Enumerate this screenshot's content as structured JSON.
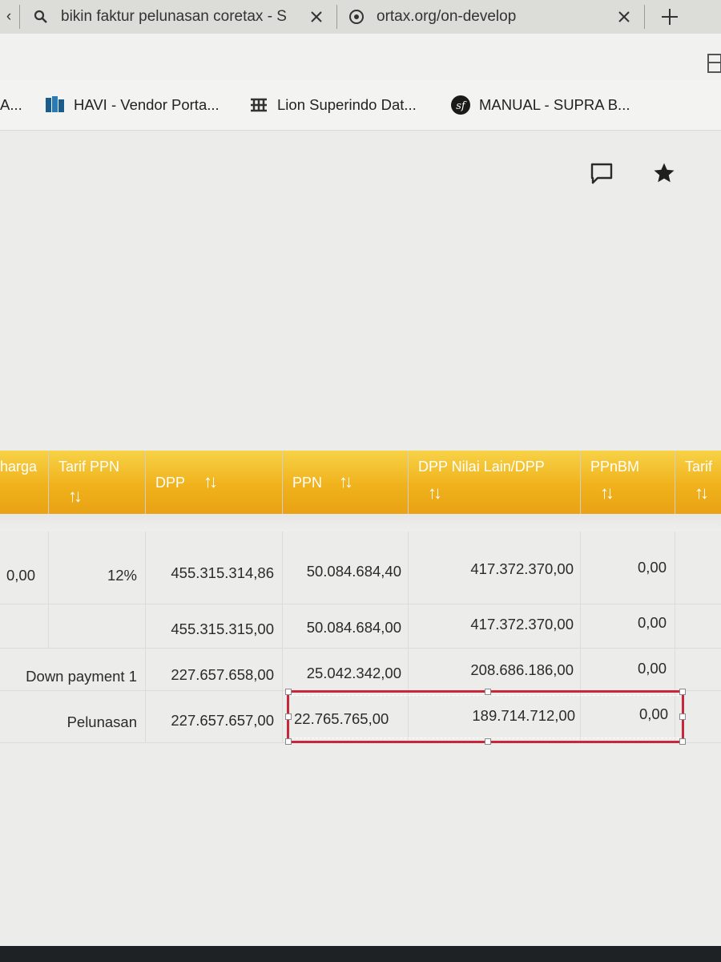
{
  "browser": {
    "back_glyph": "‹",
    "tabs": [
      {
        "title": "bikin faktur pelunasan coretax - S",
        "icon": "search-icon"
      },
      {
        "title": "ortax.org/on-develop",
        "icon": "ortax-icon"
      }
    ],
    "close_glyph": "✕",
    "new_tab_glyph": "+",
    "favorites": [
      {
        "label": "A...",
        "icon": "none"
      },
      {
        "label": "HAVI - Vendor Porta...",
        "icon": "havi-icon"
      },
      {
        "label": "Lion Superindo Dat...",
        "icon": "superindo-icon"
      },
      {
        "label": "MANUAL - SUPRA B...",
        "icon": "symfony-icon"
      }
    ]
  },
  "page_icons": [
    "feedback-icon",
    "star-icon"
  ],
  "table": {
    "headers": [
      {
        "label": "harga",
        "sortable": false
      },
      {
        "label": "Tarif PPN",
        "sortable": true
      },
      {
        "label": "DPP",
        "sortable": true
      },
      {
        "label": "PPN",
        "sortable": true
      },
      {
        "label": "DPP Nilai Lain/DPP",
        "sortable": true
      },
      {
        "label": "PPnBM",
        "sortable": true
      },
      {
        "label": "Tarif",
        "sortable": true
      }
    ],
    "sort_glyph": "↑↓",
    "rows": [
      {
        "harga": "0,00",
        "tarif": "12%",
        "dpp": "455.315.314,86",
        "ppn": "50.084.684,40",
        "dpp_lain": "417.372.370,00",
        "ppnbm": "0,00"
      },
      {
        "harga": "",
        "tarif": "",
        "dpp": "455.315.315,00",
        "ppn": "50.084.684,00",
        "dpp_lain": "417.372.370,00",
        "ppnbm": "0,00"
      },
      {
        "label": "Down payment 1",
        "dpp": "227.657.658,00",
        "ppn": "25.042.342,00",
        "dpp_lain": "208.686.186,00",
        "ppnbm": "0,00"
      },
      {
        "label": "Pelunasan",
        "dpp": "227.657.657,00",
        "ppn": "22.765.765,00",
        "dpp_lain": "189.714.712,00",
        "ppnbm": "0,00"
      }
    ]
  },
  "colors": {
    "header_orange": "#f0b21c",
    "selection_red": "#c7263b"
  }
}
